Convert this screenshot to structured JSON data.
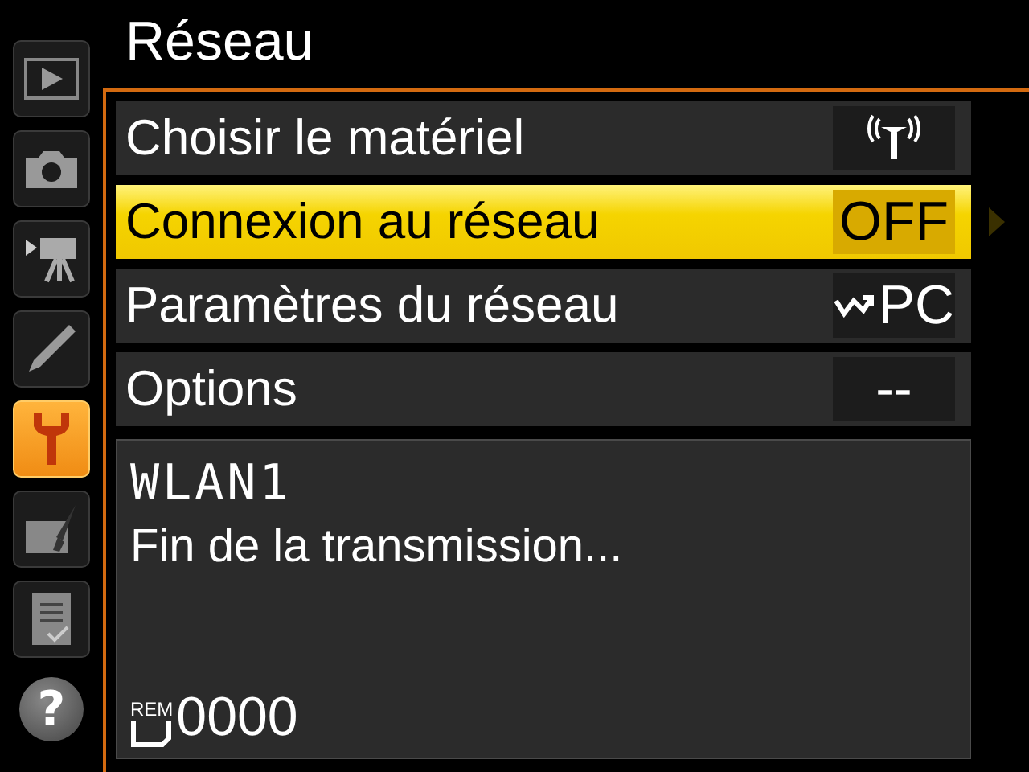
{
  "sidebar": {
    "items": [
      {
        "kind": "playback",
        "selected": false
      },
      {
        "kind": "camera",
        "selected": false
      },
      {
        "kind": "movie",
        "selected": false
      },
      {
        "kind": "pencil",
        "selected": false
      },
      {
        "kind": "wrench",
        "selected": true
      },
      {
        "kind": "retouch",
        "selected": false
      },
      {
        "kind": "list",
        "selected": false
      }
    ],
    "help": {
      "label": "?"
    }
  },
  "title": "Réseau",
  "menu": {
    "rows": [
      {
        "label": "Choisir le matériel",
        "kind": "antenna",
        "selected": false
      },
      {
        "label": "Connexion au réseau",
        "kind": "text",
        "value": "OFF",
        "selected": true
      },
      {
        "label": "Paramètres du réseau",
        "kind": "link",
        "value": "PC",
        "selected": false
      },
      {
        "label": "Options",
        "kind": "text",
        "value": "--",
        "selected": false
      }
    ]
  },
  "info": {
    "profile": "WLAN1",
    "message": "Fin de la transmission...",
    "remaining_label": "REM",
    "remaining": "0000"
  }
}
